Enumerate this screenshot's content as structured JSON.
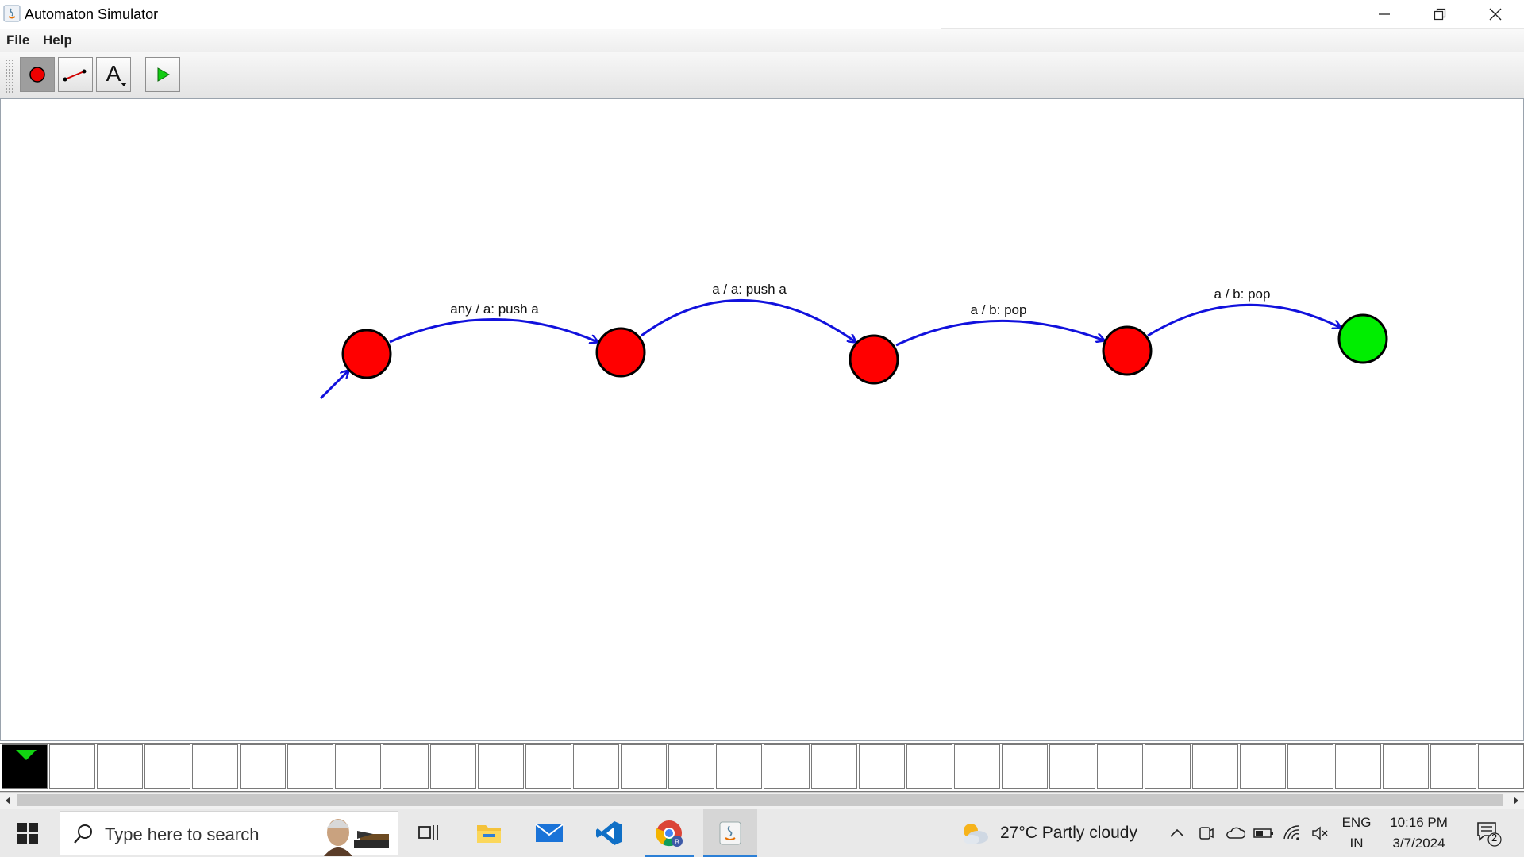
{
  "window": {
    "title": "Automaton Simulator"
  },
  "menu": {
    "items": [
      {
        "label": "File"
      },
      {
        "label": "Help"
      }
    ]
  },
  "toolbar": {
    "tools": [
      {
        "name": "state-tool",
        "active": true
      },
      {
        "name": "transition-tool",
        "active": false
      },
      {
        "name": "text-tool",
        "active": false
      },
      {
        "name": "run-tool",
        "active": false
      }
    ],
    "text_tool_glyph": "A"
  },
  "diagram": {
    "states": [
      {
        "id": "q0",
        "color": "#ff0000",
        "initial": true
      },
      {
        "id": "q1",
        "color": "#ff0000"
      },
      {
        "id": "q2",
        "color": "#ff0000"
      },
      {
        "id": "q3",
        "color": "#ff0000"
      },
      {
        "id": "q4",
        "color": "#00ee00",
        "accepting": true
      }
    ],
    "transitions": [
      {
        "from": "q0",
        "to": "q1",
        "label": "any / a: push a"
      },
      {
        "from": "q1",
        "to": "q2",
        "label": "a / a: push a"
      },
      {
        "from": "q2",
        "to": "q3",
        "label": "a / b: pop"
      },
      {
        "from": "q3",
        "to": "q4",
        "label": "a / b: pop"
      }
    ],
    "edge_color": "#1111dd"
  },
  "tape": {
    "head_color": "#11d411"
  },
  "taskbar": {
    "search_placeholder": "Type here to search",
    "weather": "27°C  Partly cloudy",
    "language_top": "ENG",
    "language_bottom": "IN",
    "time": "10:16 PM",
    "date": "3/7/2024",
    "notification_count": "2"
  }
}
